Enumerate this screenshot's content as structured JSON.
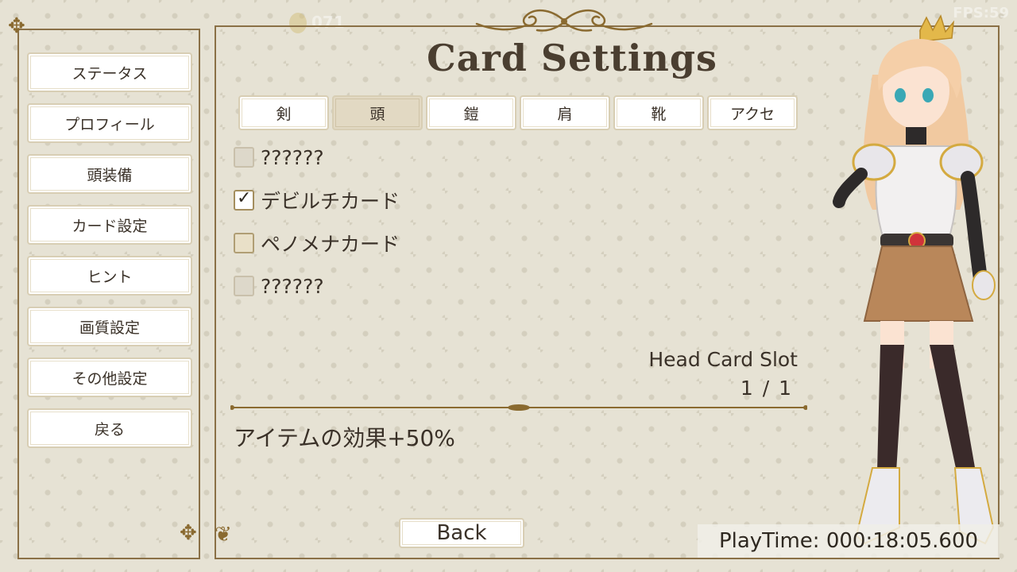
{
  "hud": {
    "fps": "FPS:59",
    "coins": "071"
  },
  "title": "Card Settings",
  "menu": {
    "items": [
      {
        "label": "ステータス"
      },
      {
        "label": "プロフィール"
      },
      {
        "label": "頭装備"
      },
      {
        "label": "カード設定"
      },
      {
        "label": "ヒント"
      },
      {
        "label": "画質設定"
      },
      {
        "label": "その他設定"
      },
      {
        "label": "戻る"
      }
    ]
  },
  "tabs": [
    {
      "label": "剣",
      "active": false
    },
    {
      "label": "頭",
      "active": true
    },
    {
      "label": "鎧",
      "active": false
    },
    {
      "label": "肩",
      "active": false
    },
    {
      "label": "靴",
      "active": false
    },
    {
      "label": "アクセ",
      "active": false
    }
  ],
  "cards": [
    {
      "label": "??????",
      "state": "locked"
    },
    {
      "label": "デビルチカード",
      "state": "checked"
    },
    {
      "label": "ペノメナカード",
      "state": "unchecked"
    },
    {
      "label": "??????",
      "state": "locked"
    }
  ],
  "slot": {
    "label": "Head Card Slot",
    "count": "1 / 1"
  },
  "effect": "アイテムの効果+50%",
  "back_label": "Back",
  "playtime": "PlayTime: 000:18:05.600",
  "colors": {
    "frame": "#8a7046",
    "background": "#e6e2d4",
    "active_tab": "#e2d9c3"
  }
}
